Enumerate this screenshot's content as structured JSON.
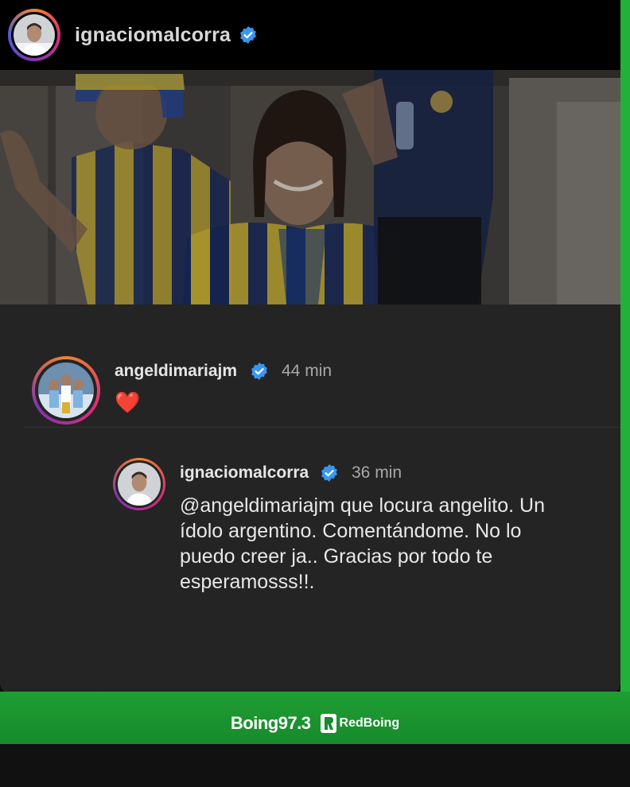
{
  "post": {
    "username": "ignaciomalcorra"
  },
  "comments": [
    {
      "username": "angeldimariajm",
      "time": "44 min",
      "text": "❤️"
    },
    {
      "username": "ignaciomalcorra",
      "time": "36 min",
      "mention": "@angeldimariajm",
      "text": " que locura angelito. Un ídolo argentino. Comentándome. No lo puedo creer ja.. Gracias por todo te esperamosss!!."
    }
  ],
  "footer": {
    "brand": "Boing97.3",
    "sub_brand": "RedBoing"
  },
  "colors": {
    "accent_green": "#22b03a",
    "verified_blue": "#3897f0",
    "comment_bg": "#242424"
  }
}
